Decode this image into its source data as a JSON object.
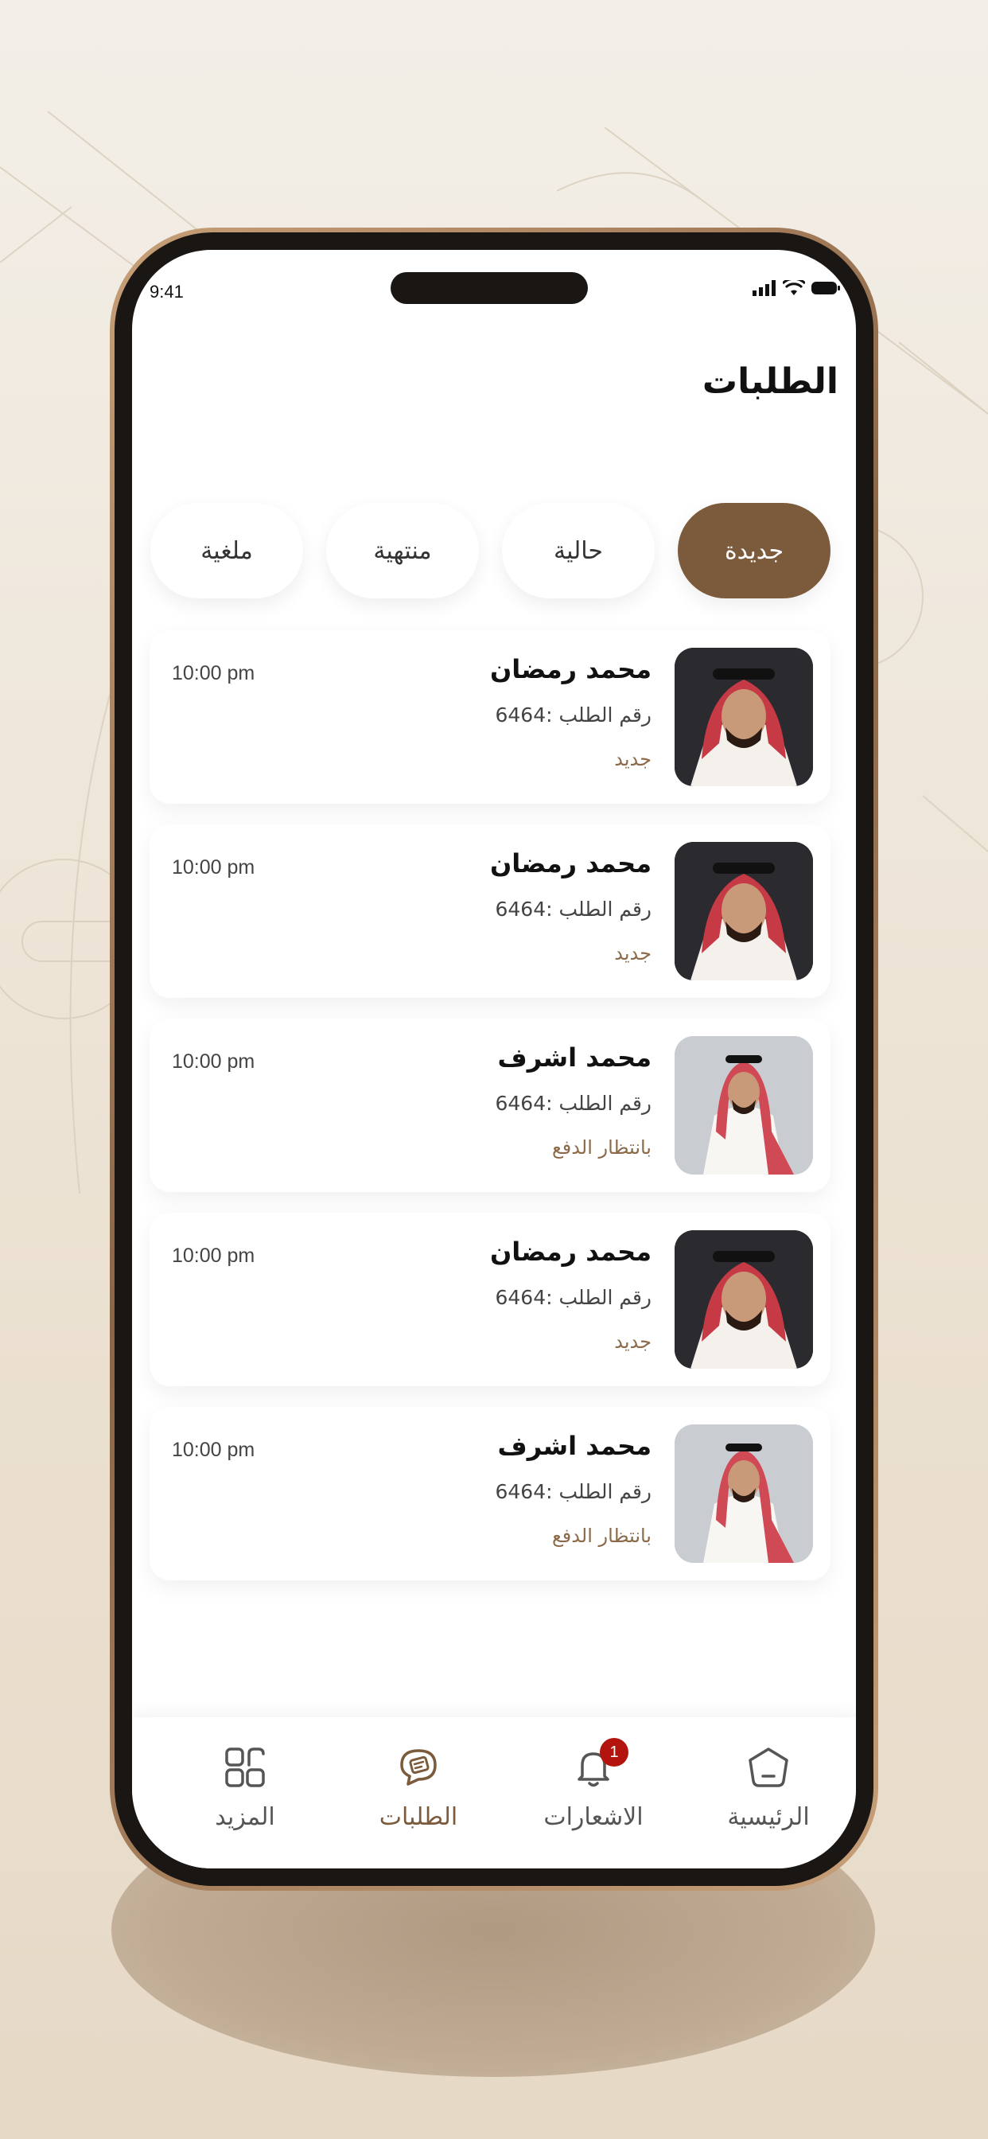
{
  "status_bar": {
    "time": "9:41"
  },
  "page": {
    "title": "الطلبات"
  },
  "tabs": [
    {
      "label": "جديدة",
      "active": true
    },
    {
      "label": "حالية",
      "active": false
    },
    {
      "label": "منتهية",
      "active": false
    },
    {
      "label": "ملغية",
      "active": false
    }
  ],
  "orders": [
    {
      "name": "محمد رمضان",
      "order_label": "رقم الطلب :6464",
      "status": "جديد",
      "time": "10:00 pm",
      "avatar": "dark"
    },
    {
      "name": "محمد رمضان",
      "order_label": "رقم الطلب :6464",
      "status": "جديد",
      "time": "10:00 pm",
      "avatar": "dark"
    },
    {
      "name": "محمد اشرف",
      "order_label": "رقم الطلب :6464",
      "status": "بانتظار الدفع",
      "time": "10:00 pm",
      "avatar": "light"
    },
    {
      "name": "محمد رمضان",
      "order_label": "رقم الطلب :6464",
      "status": "جديد",
      "time": "10:00 pm",
      "avatar": "dark"
    },
    {
      "name": "محمد اشرف",
      "order_label": "رقم الطلب :6464",
      "status": "بانتظار الدفع",
      "time": "10:00 pm",
      "avatar": "light"
    }
  ],
  "bottom_nav": {
    "home": {
      "label": "الرئيسية",
      "icon": "home-icon"
    },
    "notifications": {
      "label": "الاشعارات",
      "icon": "bell-icon",
      "badge": "1"
    },
    "orders": {
      "label": "الطلبات",
      "icon": "orders-icon",
      "active": true
    },
    "more": {
      "label": "المزيد",
      "icon": "grid-icon"
    }
  },
  "colors": {
    "accent": "#7b5b3c",
    "badge": "#b3140e",
    "status_text": "#8a6a48"
  }
}
